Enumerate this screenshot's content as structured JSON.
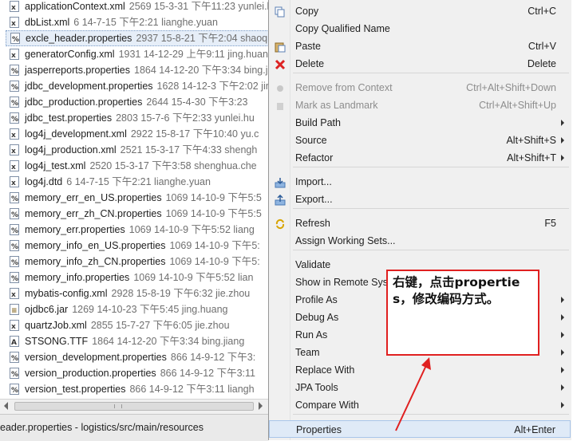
{
  "files": [
    {
      "name": "applicationContext.xml",
      "meta": "2569  15-3-31 下午11:23  yunlei.hu",
      "icon": "xml-file-icon"
    },
    {
      "name": "dbList.xml",
      "meta": "6  14-7-15 下午2:21  lianghe.yuan",
      "icon": "xml-file-icon"
    },
    {
      "name": "excle_header.properties",
      "meta": "2937  15-8-21 下午2:04  shaoqiang",
      "icon": "properties-file-icon",
      "selected": true
    },
    {
      "name": "generatorConfig.xml",
      "meta": "1931  14-12-29 上午9:11  jing.huang",
      "icon": "xml-file-icon"
    },
    {
      "name": "jasperreports.properties",
      "meta": "1864  14-12-20 下午3:34  bing.jiang",
      "icon": "properties-file-icon"
    },
    {
      "name": "jdbc_development.properties",
      "meta": "1628  14-12-3 下午2:02  jing",
      "icon": "properties-file-icon"
    },
    {
      "name": "jdbc_production.properties",
      "meta": "2644  15-4-30 下午3:23",
      "icon": "properties-file-icon"
    },
    {
      "name": "jdbc_test.properties",
      "meta": "2803  15-7-6 下午2:33  yunlei.hu",
      "icon": "properties-file-icon"
    },
    {
      "name": "log4j_development.xml",
      "meta": "2922  15-8-17 下午10:40  yu.c",
      "icon": "xml-file-icon"
    },
    {
      "name": "log4j_production.xml",
      "meta": "2521  15-3-17 下午4:33  shengh",
      "icon": "xml-file-icon"
    },
    {
      "name": "log4j_test.xml",
      "meta": "2520  15-3-17 下午3:58  shenghua.che",
      "icon": "xml-file-icon"
    },
    {
      "name": "log4j.dtd",
      "meta": "6  14-7-15 下午2:21  lianghe.yuan",
      "icon": "dtd-file-icon"
    },
    {
      "name": "memory_err_en_US.properties",
      "meta": "1069  14-10-9 下午5:5",
      "icon": "properties-file-icon"
    },
    {
      "name": "memory_err_zh_CN.properties",
      "meta": "1069  14-10-9 下午5:5",
      "icon": "properties-file-icon"
    },
    {
      "name": "memory_err.properties",
      "meta": "1069  14-10-9 下午5:52  liang",
      "icon": "properties-file-icon"
    },
    {
      "name": "memory_info_en_US.properties",
      "meta": "1069  14-10-9 下午5:",
      "icon": "properties-file-icon"
    },
    {
      "name": "memory_info_zh_CN.properties",
      "meta": "1069  14-10-9 下午5:",
      "icon": "properties-file-icon"
    },
    {
      "name": "memory_info.properties",
      "meta": "1069  14-10-9 下午5:52  lian",
      "icon": "properties-file-icon"
    },
    {
      "name": "mybatis-config.xml",
      "meta": "2928  15-8-19 下午6:32  jie.zhou",
      "icon": "xml-file-icon"
    },
    {
      "name": "ojdbc6.jar",
      "meta": "1269  14-10-23 下午5:45  jing.huang",
      "icon": "jar-file-icon"
    },
    {
      "name": "quartzJob.xml",
      "meta": "2855  15-7-27 下午6:05  jie.zhou",
      "icon": "xml-file-icon"
    },
    {
      "name": "STSONG.TTF",
      "meta": "1864  14-12-20 下午3:34  bing.jiang",
      "icon": "font-file-icon"
    },
    {
      "name": "version_development.properties",
      "meta": "866  14-9-12 下午3:",
      "icon": "properties-file-icon"
    },
    {
      "name": "version_production.properties",
      "meta": "866  14-9-12 下午3:11",
      "icon": "properties-file-icon"
    },
    {
      "name": "version_test.properties",
      "meta": "866  14-9-12 下午3:11  liangh",
      "icon": "properties-file-icon"
    }
  ],
  "status_bar": {
    "path": "eader.properties - logistics/src/main/resources"
  },
  "context_menu": {
    "items": [
      {
        "label": "Copy",
        "shortcut": "Ctrl+C",
        "icon": "copy-icon"
      },
      {
        "label": "Copy Qualified Name",
        "shortcut": ""
      },
      {
        "label": "Paste",
        "shortcut": "Ctrl+V",
        "icon": "paste-icon"
      },
      {
        "label": "Delete",
        "shortcut": "Delete",
        "icon": "delete-icon"
      },
      {
        "label": "Remove from Context",
        "shortcut": "Ctrl+Alt+Shift+Down",
        "disabled": true,
        "icon": "remove-context-icon"
      },
      {
        "label": "Mark as Landmark",
        "shortcut": "Ctrl+Alt+Shift+Up",
        "disabled": true,
        "icon": "landmark-icon"
      },
      {
        "label": "Build Path",
        "shortcut": "",
        "submenu": true
      },
      {
        "label": "Source",
        "shortcut": "Alt+Shift+S",
        "submenu": true
      },
      {
        "label": "Refactor",
        "shortcut": "Alt+Shift+T",
        "submenu": true
      },
      {
        "label": "Import...",
        "shortcut": "",
        "icon": "import-icon"
      },
      {
        "label": "Export...",
        "shortcut": "",
        "icon": "export-icon"
      },
      {
        "label": "Refresh",
        "shortcut": "F5",
        "icon": "refresh-icon"
      },
      {
        "label": "Assign Working Sets...",
        "shortcut": ""
      },
      {
        "label": "Validate",
        "shortcut": ""
      },
      {
        "label": "Show in Remote Sys",
        "shortcut": ""
      },
      {
        "label": "Profile As",
        "shortcut": "",
        "submenu": true
      },
      {
        "label": "Debug As",
        "shortcut": "",
        "submenu": true
      },
      {
        "label": "Run As",
        "shortcut": "",
        "submenu": true
      },
      {
        "label": "Team",
        "shortcut": "",
        "submenu": true
      },
      {
        "label": "Replace With",
        "shortcut": "",
        "submenu": true
      },
      {
        "label": "JPA Tools",
        "shortcut": "",
        "submenu": true
      },
      {
        "label": "Compare With",
        "shortcut": "",
        "submenu": true
      },
      {
        "label": "Properties",
        "shortcut": "Alt+Enter",
        "highlighted": true
      }
    ]
  },
  "callout": {
    "text": "右键，点击properties，修改编码方式。"
  },
  "colors": {
    "callout_border": "#e02020",
    "selection": "#e6eef8",
    "menu_bg": "#f0f0f0"
  }
}
